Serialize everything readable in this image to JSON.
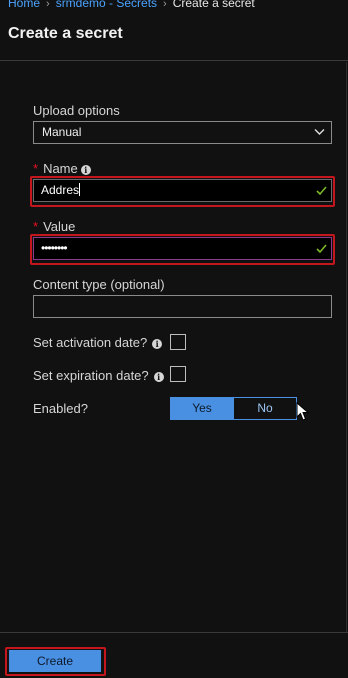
{
  "breadcrumb": {
    "items": [
      "Home",
      "srmdemo - Secrets",
      "Create a secret"
    ]
  },
  "page_title": "Create a secret",
  "form": {
    "upload_options": {
      "label": "Upload options",
      "value": "Manual"
    },
    "name": {
      "label": "Name",
      "value": "Addres",
      "required": true
    },
    "value": {
      "label": "Value",
      "value": "••••••••",
      "required": true
    },
    "content_type": {
      "label": "Content type (optional)",
      "value": ""
    },
    "activation_date": {
      "label": "Set activation date?",
      "checked": false
    },
    "expiration_date": {
      "label": "Set expiration date?",
      "checked": false
    },
    "enabled": {
      "label": "Enabled?",
      "options": [
        "Yes",
        "No"
      ],
      "selected": "Yes"
    }
  },
  "actions": {
    "create_label": "Create"
  },
  "colors": {
    "background": "#111111",
    "accent": "#4a90e2",
    "highlight": "#c5161d",
    "required": "#e81123",
    "valid_check": "#7db828"
  }
}
